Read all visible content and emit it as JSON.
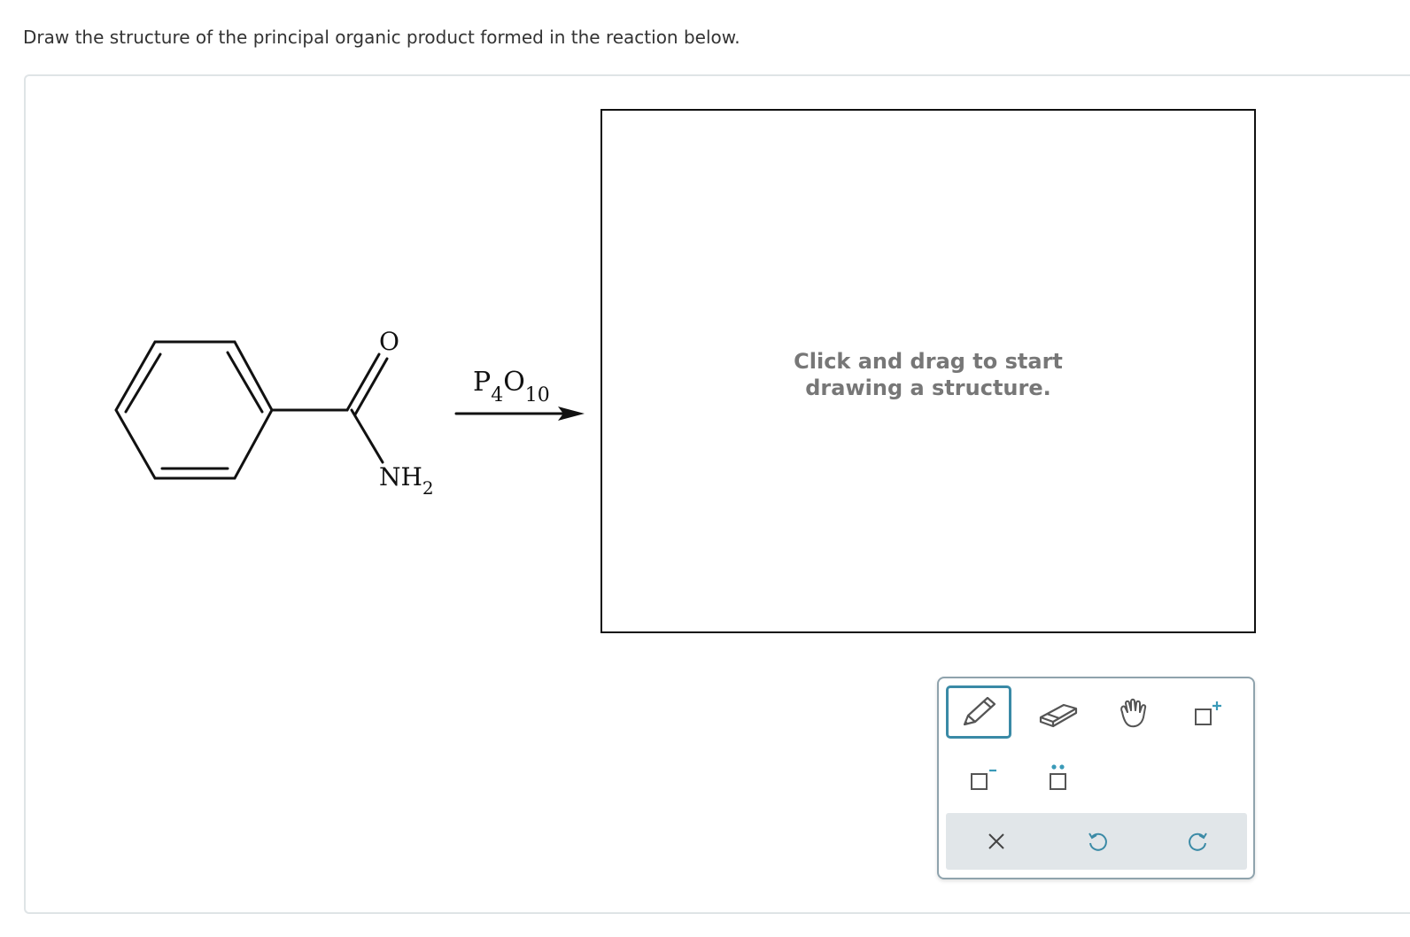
{
  "question": {
    "text": "Draw the structure of the principal organic product formed in the reaction below."
  },
  "reaction": {
    "reactant_labels": {
      "oxygen": "O",
      "amine_main": "NH",
      "amine_sub": "2"
    },
    "reagent": {
      "p": "P",
      "p_sub": "4",
      "o": "O",
      "o_sub": "10"
    }
  },
  "canvas": {
    "hint_line1": "Click and drag to start",
    "hint_line2": "drawing a structure."
  },
  "toolbar": {
    "tools": [
      "pencil-icon",
      "eraser-icon",
      "hand-icon",
      "charge-plus-icon",
      "charge-minus-icon",
      "lone-pair-icon"
    ],
    "actions": [
      "clear-icon",
      "undo-icon",
      "redo-icon"
    ],
    "selected_tool": "pencil",
    "accent_color": "#3a8aa6"
  }
}
